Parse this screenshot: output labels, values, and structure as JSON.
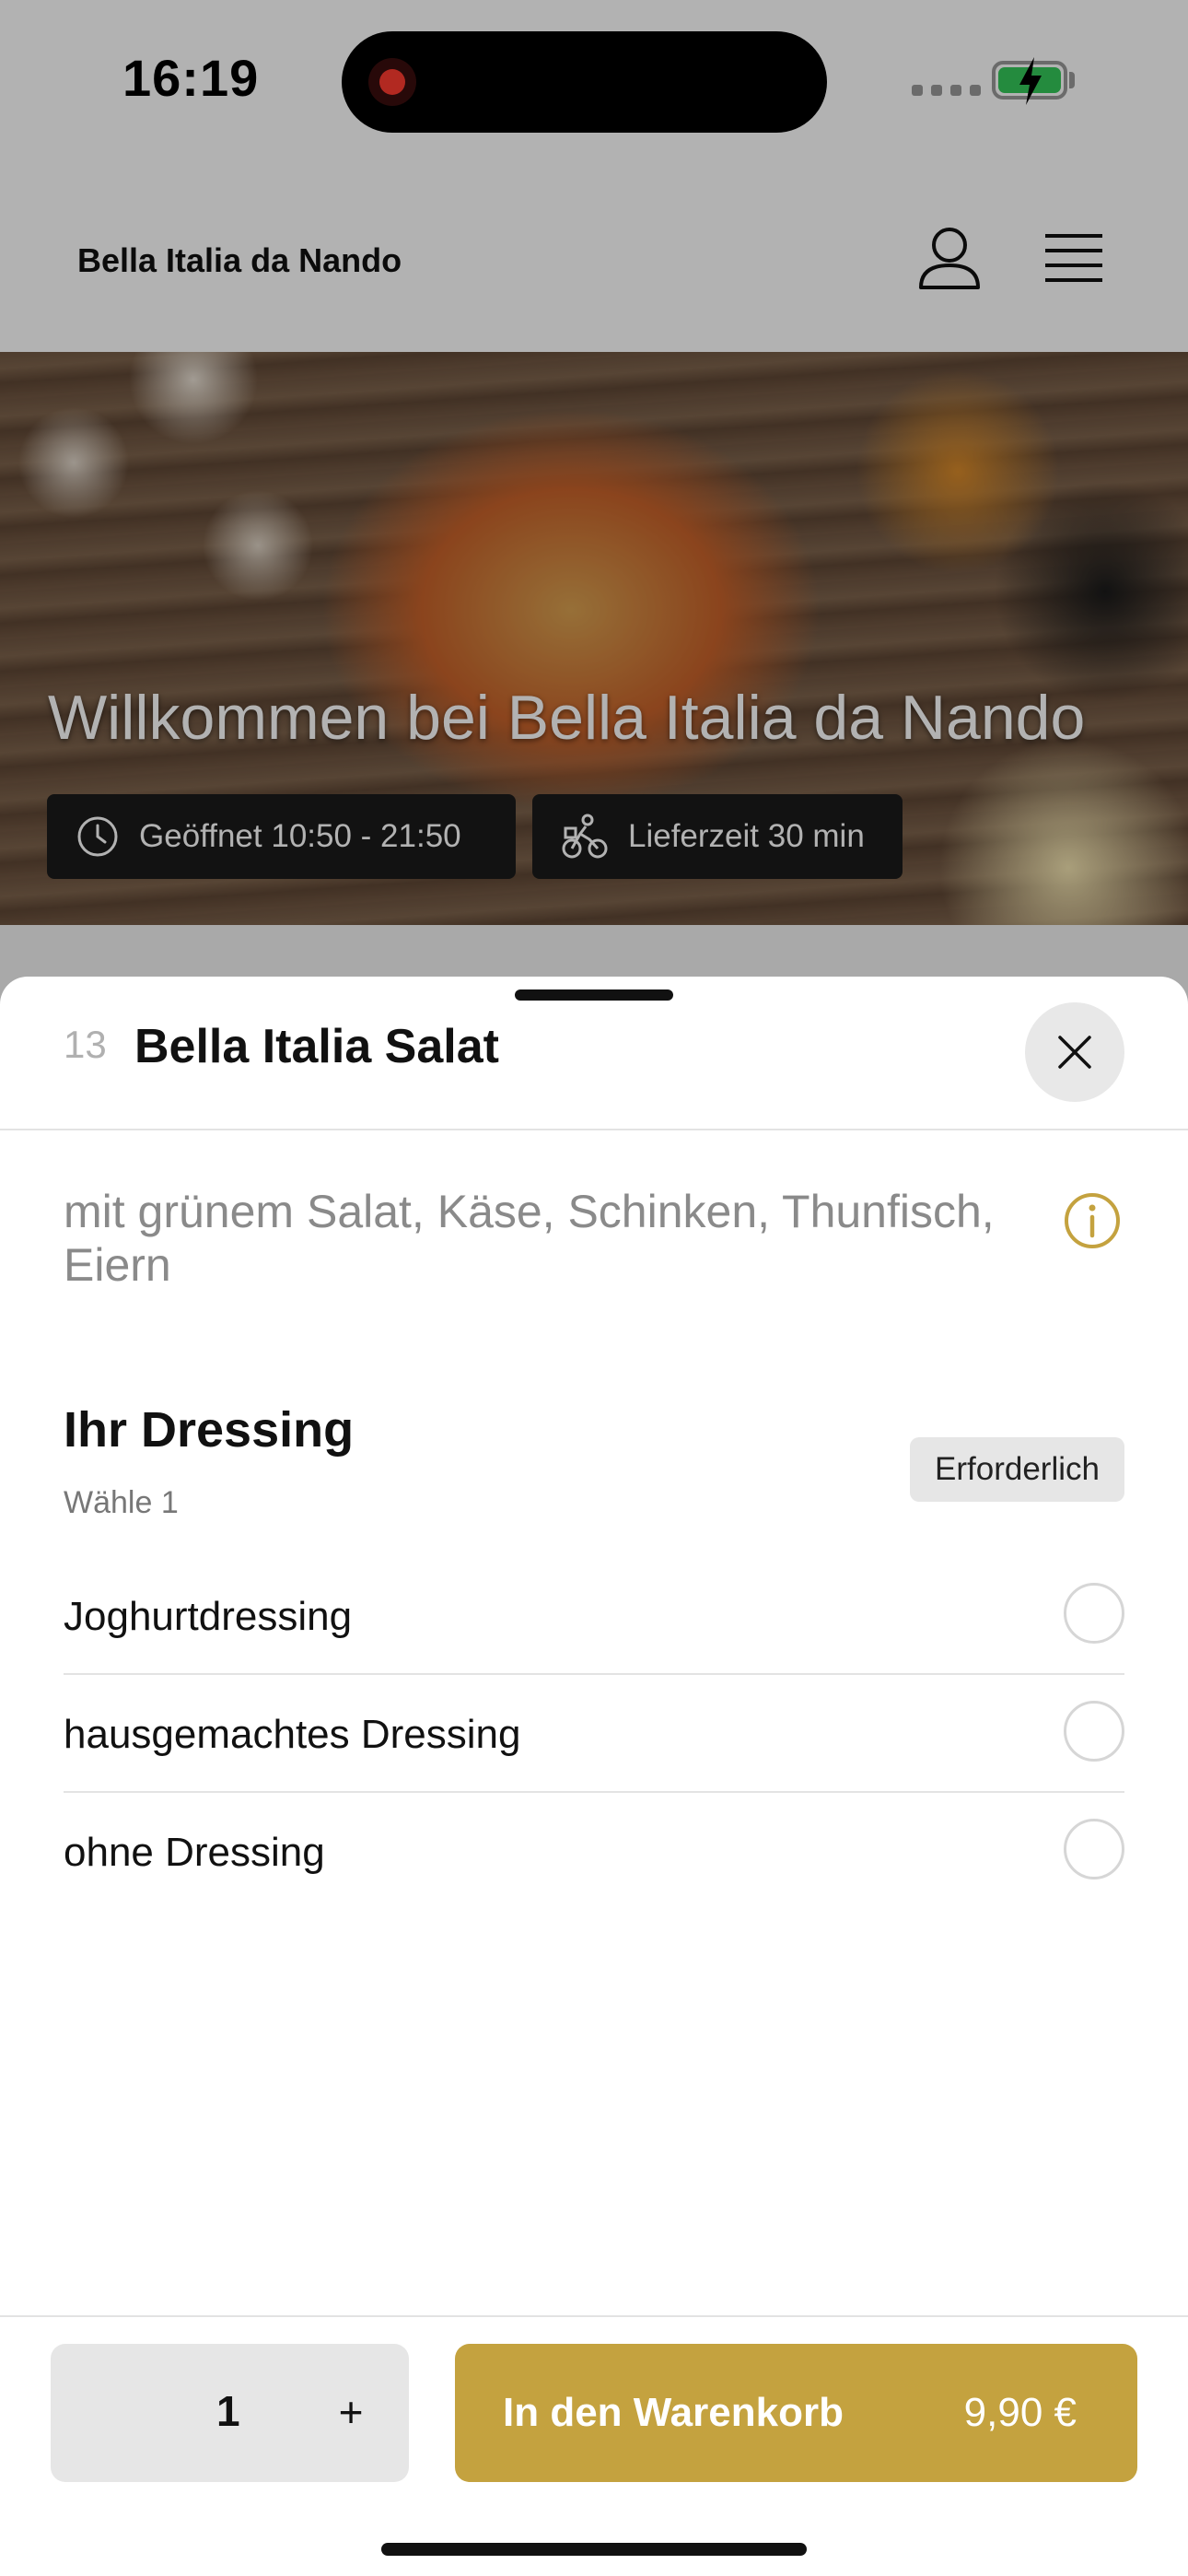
{
  "status_bar": {
    "time": "16:19"
  },
  "header": {
    "restaurant_name": "Bella Italia da Nando"
  },
  "hero": {
    "title": "Willkommen bei Bella Italia da Nando",
    "opening_hours": "Geöffnet 10:50 - 21:50",
    "delivery_time": "Lieferzeit 30 min"
  },
  "item": {
    "number": "13",
    "title": "Bella Italia Salat",
    "description": "mit grünem Salat, Käse, Schinken, Thunfisch, Eiern"
  },
  "dressing": {
    "title": "Ihr Dressing",
    "subtitle": "Wähle 1",
    "required_label": "Erforderlich",
    "options": [
      {
        "label": "Joghurtdressing",
        "selected": false
      },
      {
        "label": "hausgemachtes Dressing",
        "selected": false
      },
      {
        "label": "ohne Dressing",
        "selected": false
      }
    ]
  },
  "footer": {
    "quantity": "1",
    "plus_label": "+",
    "cart_label": "In den Warenkorb",
    "price": "9,90 €"
  },
  "colors": {
    "accent": "#c4a23f",
    "overlay": "rgba(0,0,0,0.30)"
  }
}
